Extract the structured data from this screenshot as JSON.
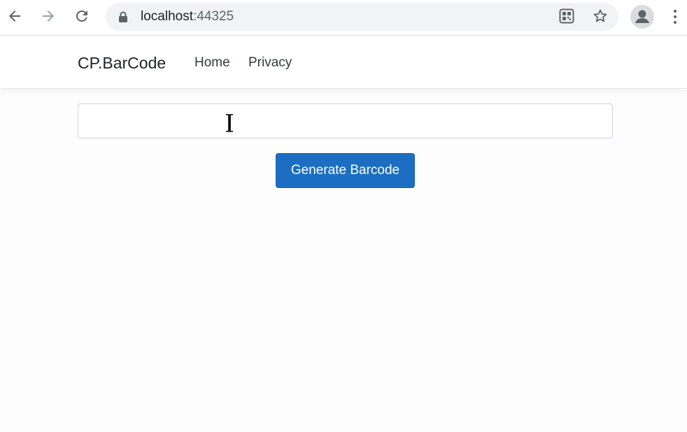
{
  "browser": {
    "url_host": "localhost",
    "url_port": ":44325",
    "icons": {
      "back": "arrow-left-icon",
      "forward": "arrow-right-icon",
      "reload": "reload-icon",
      "lock": "lock-icon",
      "qr": "qr-code-icon",
      "bookmark": "star-icon",
      "profile": "profile-icon",
      "menu": "more-vertical-icon"
    }
  },
  "navbar": {
    "brand": "CP.BarCode",
    "links": [
      "Home",
      "Privacy"
    ]
  },
  "main": {
    "input_value": "",
    "input_placeholder": "",
    "button_label": "Generate Barcode"
  },
  "colors": {
    "primary_button": "#1b6ec2",
    "page_background": "#fdfdfd"
  }
}
